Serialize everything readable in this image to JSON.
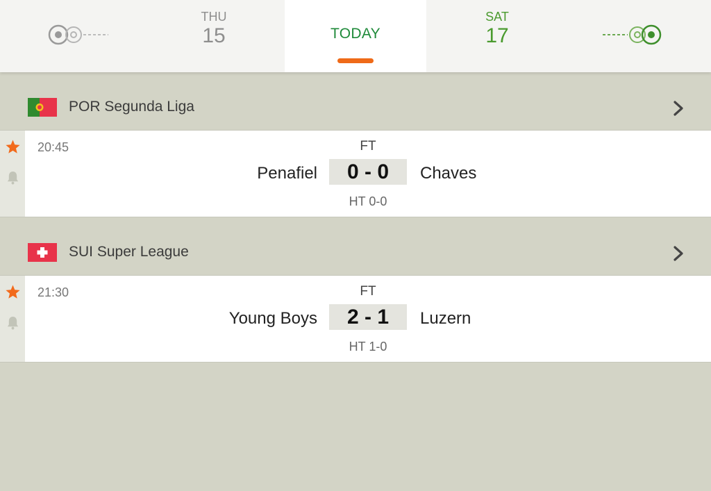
{
  "datebar": {
    "prev": {
      "day": "THU",
      "date": "15"
    },
    "today_label": "TODAY",
    "next": {
      "day": "SAT",
      "date": "17"
    }
  },
  "colors": {
    "accent_underline": "#ef6a18",
    "today_text": "#1f8a3a",
    "next_day_text": "#4a9a2e",
    "star": "#f26a1b",
    "background": "#d3d4c6"
  },
  "leagues": [
    {
      "name": "POR Segunda Liga",
      "flag_icon": "portugal-flag-icon",
      "match": {
        "time": "20:45",
        "status": "FT",
        "home": "Penafiel",
        "score": "0 - 0",
        "away": "Chaves",
        "halftime": "HT 0-0"
      }
    },
    {
      "name": "SUI Super League",
      "flag_icon": "switzerland-flag-icon",
      "match": {
        "time": "21:30",
        "status": "FT",
        "home": "Young Boys",
        "score": "2 - 1",
        "away": "Luzern",
        "halftime": "HT 1-0"
      }
    }
  ]
}
